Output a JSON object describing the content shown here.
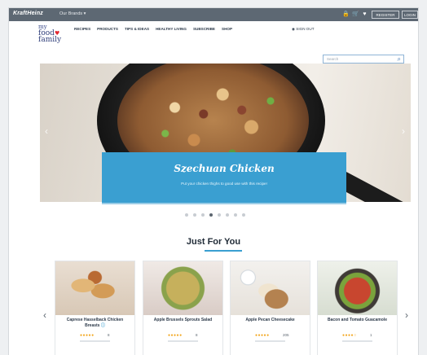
{
  "topbar": {
    "brand": "KraftHeinz",
    "brands_menu": "Our Brands ▾",
    "register_label": "REGISTER",
    "login_label": "LOGIN"
  },
  "nav": {
    "logo_line1": "my",
    "logo_line2": "food",
    "logo_line3": "family",
    "links": [
      "RECIPES",
      "PRODUCTS",
      "TIPS & IDEAS",
      "HEALTHY LIVING",
      "SUBSCRIBE",
      "SHOP"
    ],
    "signout_label": "SIGN OUT"
  },
  "search": {
    "placeholder": "Search"
  },
  "hero": {
    "title": "Szechuan Chicken",
    "subtitle": "Put your chicken thighs to good use with this recipe!",
    "slide_count": 8,
    "active_slide": 4
  },
  "just_for_you": {
    "title": "Just For You",
    "cards": [
      {
        "name": "Caprese Hasselback Chicken Breasts",
        "stars": "●●●●●",
        "count": "8"
      },
      {
        "name": "Apple Brussels Sprouts Salad",
        "stars": "●●●●●",
        "count": "8"
      },
      {
        "name": "Apple Pecan Cheesecake",
        "stars": "●●●●●",
        "count": "205"
      },
      {
        "name": "Bacon and Tomato Guacamole",
        "stars": "●●●●○",
        "count": "1"
      }
    ]
  }
}
